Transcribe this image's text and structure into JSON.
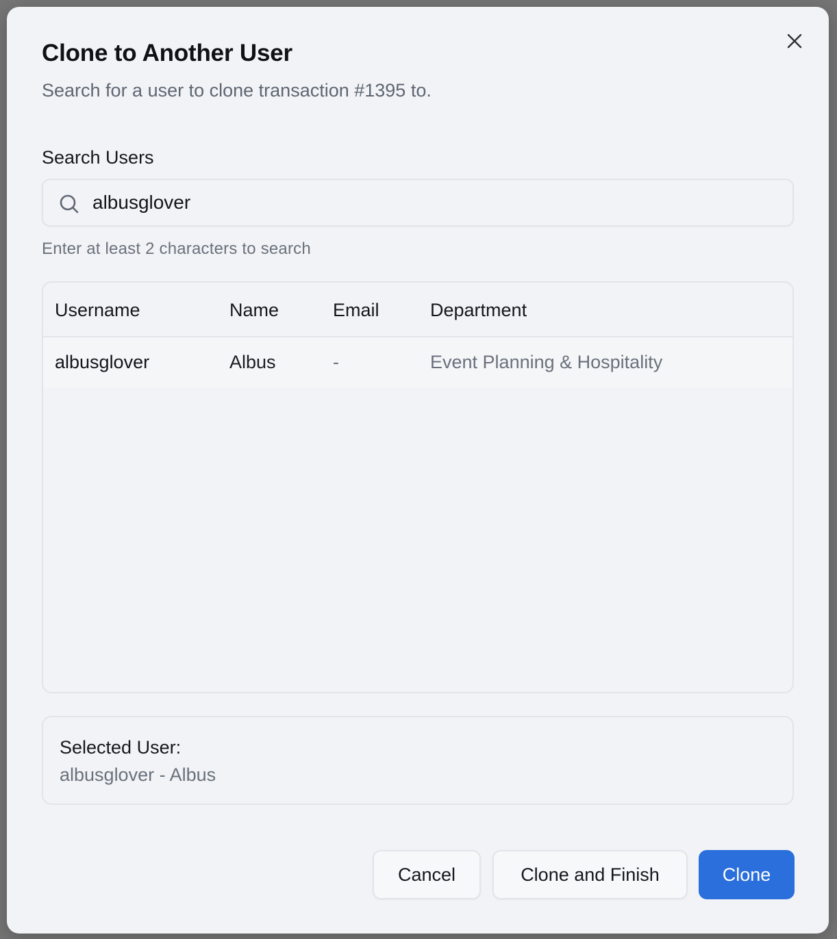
{
  "dialog": {
    "title": "Clone to Another User",
    "subtitle": "Search for a user to clone transaction #1395 to.",
    "close_icon": "close-icon"
  },
  "search": {
    "label": "Search Users",
    "value": "albusglover",
    "placeholder": "",
    "icon": "search-icon",
    "hint": "Enter at least 2 characters to search"
  },
  "table": {
    "columns": [
      "Username",
      "Name",
      "Email",
      "Department"
    ],
    "rows": [
      {
        "username": "albusglover",
        "name": "Albus",
        "email": "-",
        "department": "Event Planning & Hospitality"
      }
    ]
  },
  "selected": {
    "label": "Selected User:",
    "value": "albusglover - Albus"
  },
  "actions": {
    "cancel_label": "Cancel",
    "clone_finish_label": "Clone and Finish",
    "clone_label": "Clone"
  },
  "colors": {
    "primary": "#2a6fdb",
    "background": "#f1f3f6",
    "muted_text": "#6a717c"
  }
}
